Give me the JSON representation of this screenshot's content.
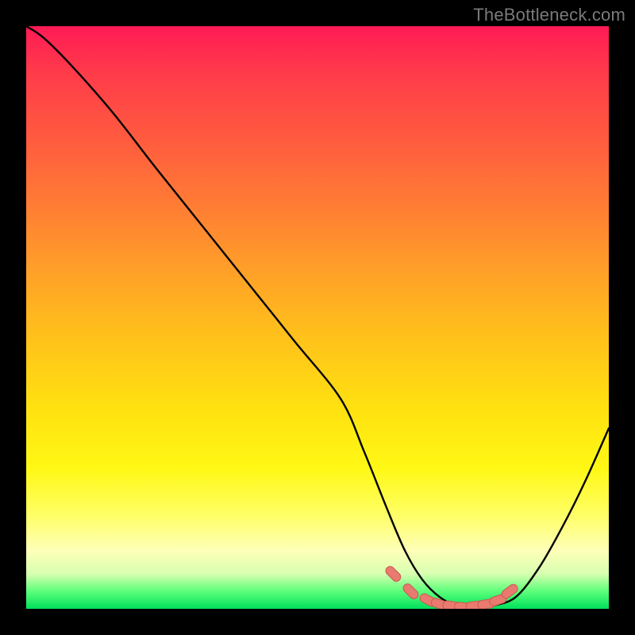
{
  "watermark": "TheBottleneck.com",
  "colors": {
    "frame": "#000000",
    "curve": "#000000",
    "marker_fill": "#e87a6f",
    "marker_stroke": "#c95b50",
    "gradient_top": "#ff1a55",
    "gradient_bottom": "#00e05c"
  },
  "chart_data": {
    "type": "line",
    "title": "",
    "xlabel": "",
    "ylabel": "",
    "xlim": [
      0,
      100
    ],
    "ylim": [
      0,
      100
    ],
    "grid": false,
    "legend": false,
    "series": [
      {
        "name": "bottleneck-curve",
        "x": [
          0,
          3,
          8,
          15,
          22,
          30,
          38,
          46,
          54,
          58,
          62,
          65,
          68,
          71,
          74,
          77,
          80,
          84,
          88,
          92,
          96,
          100
        ],
        "values": [
          100,
          98,
          93,
          85,
          76,
          66,
          56,
          46,
          36,
          27,
          17,
          10,
          5,
          2,
          0.5,
          0,
          0.5,
          2,
          7,
          14,
          22,
          31
        ]
      }
    ],
    "markers": {
      "name": "optimal-range",
      "x": [
        63,
        66,
        69,
        71,
        73,
        75,
        77,
        79,
        81,
        83
      ],
      "values": [
        6,
        3,
        1.5,
        0.8,
        0.5,
        0.3,
        0.5,
        0.8,
        1.5,
        3
      ]
    }
  }
}
